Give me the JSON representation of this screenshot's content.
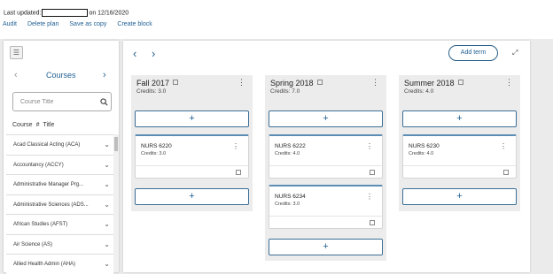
{
  "header": {
    "last_updated_label": "Last updated:",
    "last_updated_suffix": "on 12/16/2020",
    "actions": [
      "Audit",
      "Delete plan",
      "Save as copy",
      "Create block"
    ]
  },
  "sidebar": {
    "title": "Courses",
    "search_placeholder": "Course Title",
    "columns": {
      "course": "Course",
      "num": "#",
      "title": "Title"
    },
    "courses": [
      "Acad Classical Acting (ACA)",
      "Accountancy (ACCY)",
      "Administrative Manager Prg...",
      "Administrative Sciences (ADS...",
      "African Studies (AFST)",
      "Air Science (AS)",
      "Allied Health Admin (AHA)"
    ]
  },
  "main": {
    "add_term_label": "Add term",
    "add_symbol": "+",
    "terms": [
      {
        "name": "Fall 2017",
        "credits": "Credits:  3.0",
        "courses": [
          {
            "code": "NURS 6220",
            "credits": "Credits: 3.0"
          }
        ]
      },
      {
        "name": "Spring 2018",
        "credits": "Credits:  7.0",
        "courses": [
          {
            "code": "NURS 6222",
            "credits": "Credits: 4.0"
          },
          {
            "code": "NURS 6234",
            "credits": "Credits: 3.0"
          }
        ]
      },
      {
        "name": "Summer 2018",
        "credits": "Credits:  4.0",
        "courses": [
          {
            "code": "NURS 6230",
            "credits": "Credits: 4.0"
          }
        ]
      }
    ]
  },
  "colors": {
    "accent": "#1f5f93",
    "card_border": "#5c8db5",
    "column_bg": "#ececec",
    "page_bg": "#ebebeb"
  },
  "icons": [
    "menu-icon",
    "chevron-left-icon",
    "chevron-right-icon",
    "search-icon",
    "note-icon",
    "kebab-icon",
    "expand-icon",
    "chevron-down-icon"
  ]
}
